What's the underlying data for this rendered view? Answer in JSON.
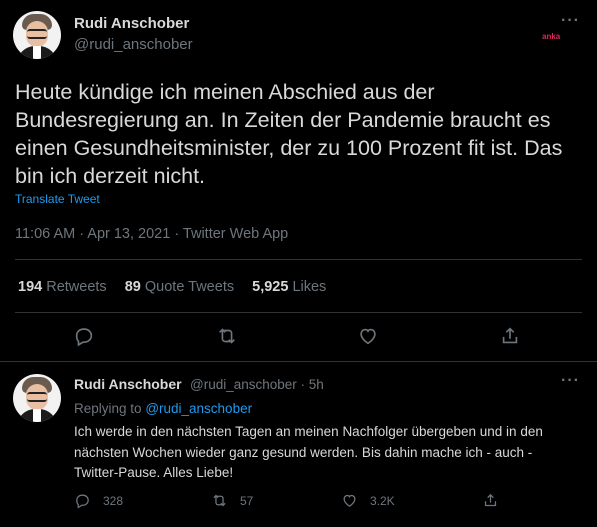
{
  "main_tweet": {
    "author_name": "Rudi Anschober",
    "author_handle": "@rudi_anschober",
    "text": "Heute kündige ich meinen Abschied aus der Bundesregierung an. In Zeiten der Pandemie braucht es einen Gesundheitsminister, der zu 100 Prozent fit ist. Das bin ich derzeit nicht.",
    "translate_label": "Translate Tweet",
    "timestamp": "11:06 AM · Apr 13, 2021 · Twitter Web App",
    "stats": {
      "retweets_count": "194",
      "retweets_label": "Retweets",
      "quotes_count": "89",
      "quotes_label": "Quote Tweets",
      "likes_count": "5,925",
      "likes_label": "Likes"
    },
    "watermark": "anka"
  },
  "reply_tweet": {
    "author_name": "Rudi Anschober",
    "author_handle": "@rudi_anschober",
    "time": "· 5h",
    "replying_to_label": "Replying to",
    "replying_to_handle": "@rudi_anschober",
    "text": "Ich werde in den nächsten Tagen an meinen Nachfolger übergeben und in den nächsten Wochen wieder ganz gesund werden. Bis dahin mache ich - auch - Twitter-Pause. Alles Liebe!",
    "replies": "328",
    "retweets": "57",
    "likes": "3.2K"
  },
  "icons": [
    "more-icon",
    "reply-icon",
    "retweet-icon",
    "like-icon",
    "share-icon"
  ],
  "colors": {
    "background": "#000000",
    "accent": "#1d9bf0",
    "muted": "#6e767d",
    "text": "#d9d9d9",
    "divider": "#2f3336"
  }
}
